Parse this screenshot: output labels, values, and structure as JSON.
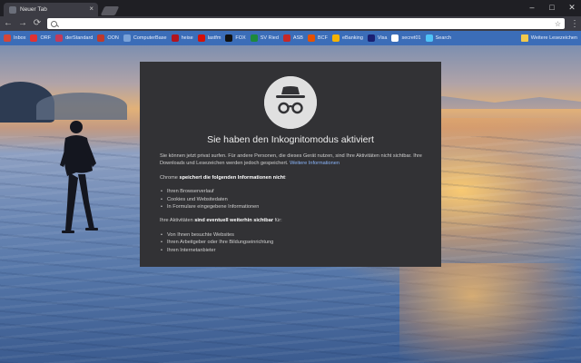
{
  "tab": {
    "title": "Neuer Tab",
    "close_icon": "×"
  },
  "window_controls": [
    "–",
    "□",
    "✕"
  ],
  "toolbar": {
    "back": "←",
    "forward": "→",
    "reload": "⟳",
    "address_value": "",
    "star": "☆",
    "menu": "⋮"
  },
  "bookmarks": {
    "items": [
      {
        "label": "Inbox",
        "color": "#d44638"
      },
      {
        "label": "ORF",
        "color": "#e03232"
      },
      {
        "label": "derStandard",
        "color": "#c23a5a"
      },
      {
        "label": "OON",
        "color": "#c0392b"
      },
      {
        "label": "ComputerBase",
        "color": "#7aa2d8"
      },
      {
        "label": "heise",
        "color": "#b3151f"
      },
      {
        "label": "lastfm",
        "color": "#d51007"
      },
      {
        "label": "FOX",
        "color": "#111111"
      },
      {
        "label": "SV Ried",
        "color": "#1e8a3c"
      },
      {
        "label": "ASB",
        "color": "#c62828"
      },
      {
        "label": "BCF",
        "color": "#e65100"
      },
      {
        "label": "eBanking",
        "color": "#f6b300"
      },
      {
        "label": "Visa",
        "color": "#1a1f71"
      },
      {
        "label": "secret01",
        "color": "#ffffff"
      },
      {
        "label": "Search",
        "color": "#4fc3f7"
      }
    ],
    "folder": {
      "label": "Weitere Lesezeichen",
      "color": "#f2c94c"
    }
  },
  "card": {
    "title": "Sie haben den Inkognitomodus aktiviert",
    "intro": "Sie können jetzt privat surfen. Für andere Personen, die dieses Gerät nutzen, sind Ihre Aktivitäten nicht sichtbar. Ihre Downloads und Lesezeichen werden jedoch gespeichert.",
    "learn_more": "Weitere Informationen",
    "not_saved_prefix": "Chrome",
    "not_saved_bold": "speichert die folgenden Informationen nicht",
    "not_saved_suffix": ":",
    "not_saved_items": [
      "Ihren Browserverlauf",
      "Cookies und Websitedaten",
      "In Formulare eingegebene Informationen"
    ],
    "visible_prefix": "Ihre Aktivitäten",
    "visible_bold": "sind eventuell weiterhin sichtbar",
    "visible_suffix": "für:",
    "visible_items": [
      "Von Ihnen besuchte Websites",
      "Ihren Arbeitgeber oder Ihre Bildungseinrichtung",
      "Ihren Internetanbieter"
    ]
  }
}
